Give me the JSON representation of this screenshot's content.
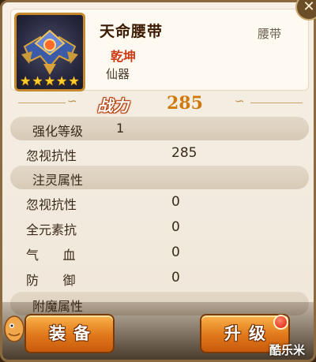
{
  "item": {
    "name": "天命腰带",
    "type": "腰带",
    "quality_tag": "乾坤",
    "category": "仙器",
    "stars": [
      "★",
      "★",
      "★",
      "★",
      "★"
    ]
  },
  "power": {
    "label": "战力",
    "value": "285"
  },
  "enhance": {
    "label": "强化等级",
    "value": "1"
  },
  "base_stat": {
    "label": "忽视抗性",
    "value": "285"
  },
  "spirit": {
    "title": "注灵属性",
    "rows": [
      {
        "label": "忽视抗性",
        "value": "0"
      },
      {
        "label": "全元素抗",
        "value": "0"
      },
      {
        "label": "气      血",
        "value": "0"
      },
      {
        "label": "防      御",
        "value": "0"
      }
    ]
  },
  "enchant": {
    "title": "附魔属性"
  },
  "buttons": {
    "equip": "装备",
    "upgrade": "升级"
  },
  "watermark": "酷乐米",
  "colors": {
    "accent": "#e0781a",
    "power_value": "#cf7a0e",
    "quality": "#cc3a14"
  }
}
